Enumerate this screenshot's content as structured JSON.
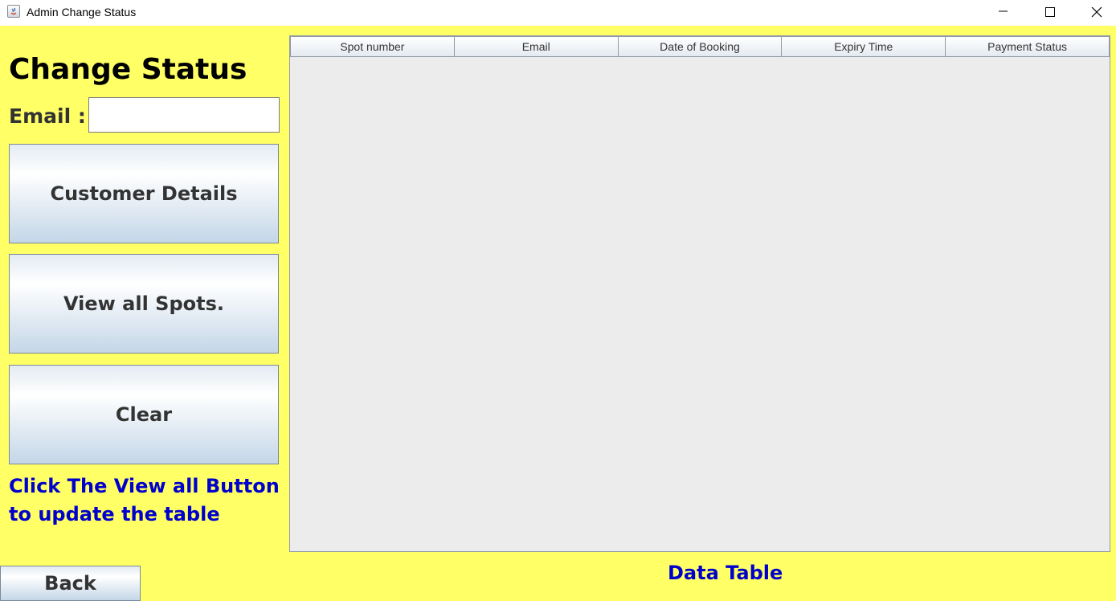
{
  "window": {
    "title": "Admin Change Status",
    "icon": "java-app-icon"
  },
  "form": {
    "heading": "Change Status",
    "email_label": "Email :",
    "email_value": "",
    "email_placeholder": ""
  },
  "buttons": {
    "customer_details": "Customer Details",
    "view_all_spots": "View all Spots.",
    "clear": "Clear",
    "back": "Back"
  },
  "hint": "Click The View all Button to update the table",
  "table": {
    "columns": [
      "Spot number",
      "Email",
      "Date of Booking",
      "Expiry Time",
      "Payment Status"
    ],
    "rows": []
  },
  "table_caption": "Data Table",
  "colors": {
    "background": "#ffff66",
    "hint_text": "#0000cc",
    "table_body": "#ececec"
  }
}
